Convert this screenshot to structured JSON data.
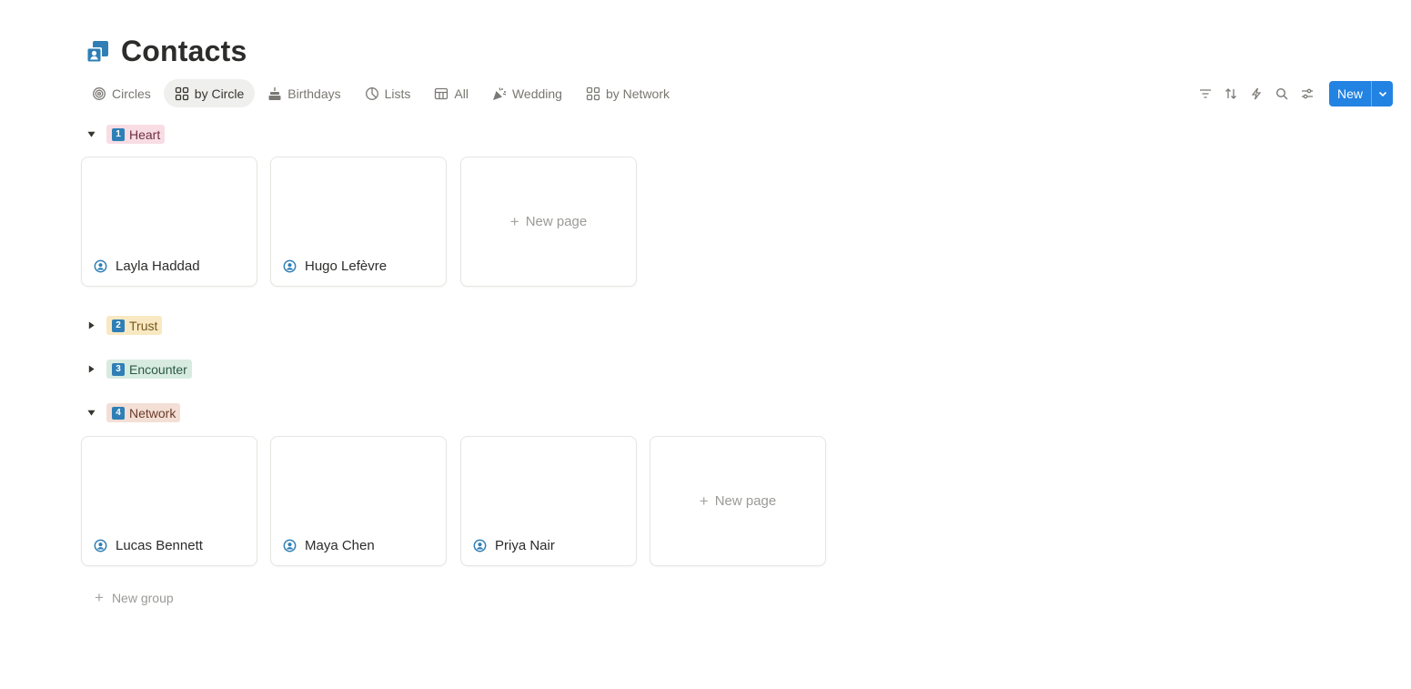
{
  "page": {
    "title": "Contacts"
  },
  "tabs": [
    {
      "label": "Circles",
      "icon": "target-icon",
      "active": false
    },
    {
      "label": "by Circle",
      "icon": "board-icon",
      "active": true
    },
    {
      "label": "Birthdays",
      "icon": "cake-icon",
      "active": false
    },
    {
      "label": "Lists",
      "icon": "chart-icon",
      "active": false
    },
    {
      "label": "All",
      "icon": "table-icon",
      "active": false
    },
    {
      "label": "Wedding",
      "icon": "party-icon",
      "active": false
    },
    {
      "label": "by Network",
      "icon": "board-icon",
      "active": false
    }
  ],
  "toolbar": {
    "icons": [
      "filter-icon",
      "sort-icon",
      "lightning-icon",
      "search-icon",
      "settings-icon"
    ],
    "new_label": "New",
    "accent_color": "#2383e2"
  },
  "groups": [
    {
      "number": "1",
      "label": "Heart",
      "color": "#f8dde5",
      "text_color": "#6e2f40",
      "expanded": true,
      "cards": [
        "Layla Haddad",
        "Hugo Lefèvre"
      ]
    },
    {
      "number": "2",
      "label": "Trust",
      "color": "#f9e9c3",
      "text_color": "#76561c",
      "expanded": false,
      "cards": []
    },
    {
      "number": "3",
      "label": "Encounter",
      "color": "#d8ebe1",
      "text_color": "#2b5a42",
      "expanded": false,
      "cards": []
    },
    {
      "number": "4",
      "label": "Network",
      "color": "#f3dfd6",
      "text_color": "#6b3c2a",
      "expanded": true,
      "cards": [
        "Lucas Bennett",
        "Maya Chen",
        "Priya Nair"
      ]
    }
  ],
  "board": {
    "new_page_label": "New page",
    "new_group_label": "New group"
  }
}
